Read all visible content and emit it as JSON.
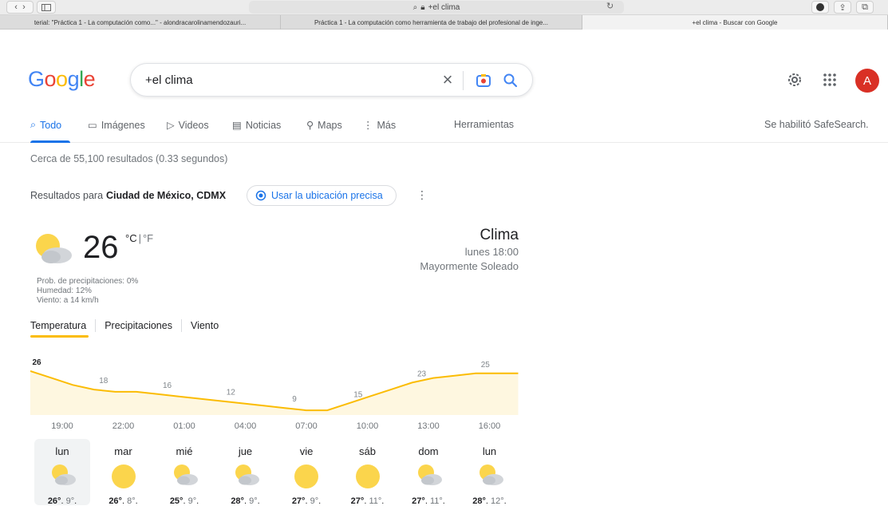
{
  "browser": {
    "address": "+el clima",
    "tabs": [
      "terial: \"Práctica 1 - La computación como...\" - alondracarolinamendozauri...",
      "Práctica 1 - La computación como herramienta de trabajo del profesional de inge...",
      "+el clima - Buscar con Google"
    ]
  },
  "header": {
    "logo": "Google",
    "query": "+el clima",
    "avatar_letter": "A"
  },
  "nav": {
    "items": [
      "Todo",
      "Imágenes",
      "Videos",
      "Noticias",
      "Maps",
      "Más"
    ],
    "tools": "Herramientas",
    "safesearch": "Se habilitó SafeSearch."
  },
  "stats": "Cerca de 55,100 resultados (0.33 segundos)",
  "location": {
    "prefix": "Resultados para",
    "place": "Ciudad de México, CDMX",
    "precise_button": "Usar la ubicación precisa"
  },
  "weather": {
    "temp": "26",
    "unit_c": "°C",
    "unit_sep": "|",
    "unit_f": "°F",
    "title": "Clima",
    "time": "lunes 18:00",
    "condition": "Mayormente Soleado",
    "precip": "Prob. de precipitaciones: 0%",
    "humidity": "Humedad: 12%",
    "wind": "Viento: a 14 km/h",
    "tabs": [
      "Temperatura",
      "Precipitaciones",
      "Viento"
    ],
    "accent": "#fbbc04"
  },
  "chart_data": {
    "type": "area",
    "x": [
      "19:00",
      "20:00",
      "21:00",
      "22:00",
      "23:00",
      "00:00",
      "01:00",
      "02:00",
      "03:00",
      "04:00",
      "05:00",
      "06:00",
      "07:00",
      "08:00",
      "09:00",
      "10:00",
      "11:00",
      "12:00",
      "13:00",
      "14:00",
      "15:00",
      "16:00",
      "17:00",
      "18:00"
    ],
    "values": [
      26,
      23,
      20,
      18,
      17,
      17,
      16,
      15,
      14,
      13,
      12,
      11,
      10,
      9,
      9,
      12,
      15,
      18,
      21,
      23,
      24,
      25,
      25,
      25
    ],
    "labels": [
      "26",
      "18",
      "16",
      "12",
      "9",
      "15",
      "23",
      "25"
    ],
    "label_index": [
      0,
      3,
      6,
      9,
      12,
      15,
      18,
      21
    ],
    "hour_ticks": [
      "19:00",
      "22:00",
      "01:00",
      "04:00",
      "07:00",
      "10:00",
      "13:00",
      "16:00"
    ],
    "ylim": [
      0,
      30
    ],
    "color": "#fbbc04",
    "fill": "#fef7e0"
  },
  "forecast": [
    {
      "day": "lun",
      "icon": "partly-cloudy",
      "hi": "26°",
      "lo": "9°"
    },
    {
      "day": "mar",
      "icon": "sunny",
      "hi": "26°",
      "lo": "8°"
    },
    {
      "day": "mié",
      "icon": "partly-cloudy",
      "hi": "25°",
      "lo": "9°"
    },
    {
      "day": "jue",
      "icon": "partly-cloudy",
      "hi": "28°",
      "lo": "9°"
    },
    {
      "day": "vie",
      "icon": "sunny",
      "hi": "27°",
      "lo": "9°"
    },
    {
      "day": "sáb",
      "icon": "sunny",
      "hi": "27°",
      "lo": "11°"
    },
    {
      "day": "dom",
      "icon": "partly-cloudy",
      "hi": "27°",
      "lo": "11°"
    },
    {
      "day": "lun",
      "icon": "partly-cloudy",
      "hi": "28°",
      "lo": "12°"
    }
  ]
}
